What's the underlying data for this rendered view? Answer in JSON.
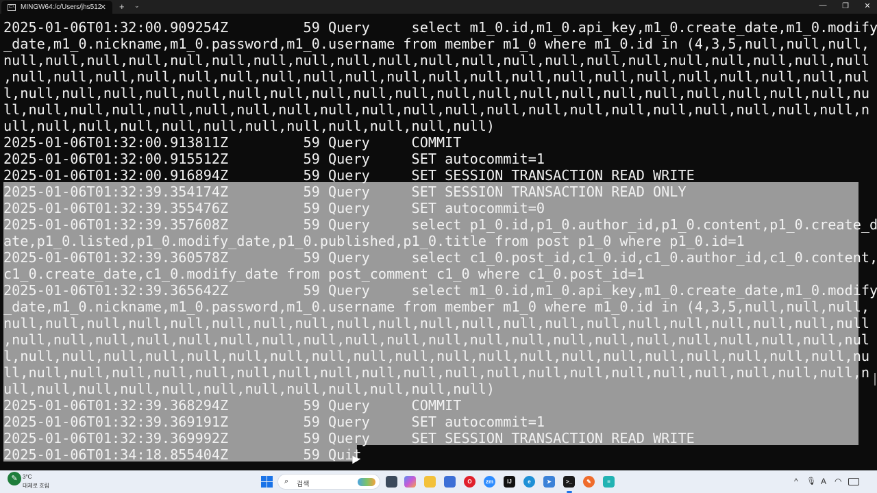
{
  "window": {
    "tab_title": "MINGW64:/c/Users/jhs512",
    "tab_icon_text": "C:\\",
    "new_tab_glyph": "+",
    "dropdown_glyph": "⌄",
    "close_glyph": "✕",
    "minimize_glyph": "—",
    "maximize_glyph": "❐"
  },
  "terminal": {
    "lines": [
      "2025-01-06T01:32:00.909254Z\t    59 Query\t select m1_0.id,m1_0.api_key,m1_0.create_date,m1_0.modify",
      "_date,m1_0.nickname,m1_0.password,m1_0.username from member m1_0 where m1_0.id in (4,3,5,null,null,null,",
      "null,null,null,null,null,null,null,null,null,null,null,null,null,null,null,null,null,null,null,null,null",
      ",null,null,null,null,null,null,null,null,null,null,null,null,null,null,null,null,null,null,null,null,nul",
      "l,null,null,null,null,null,null,null,null,null,null,null,null,null,null,null,null,null,null,null,null,nu",
      "ll,null,null,null,null,null,null,null,null,null,null,null,null,null,null,null,null,null,null,null,null,n",
      "ull,null,null,null,null,null,null,null,null,null,null,null)",
      "2025-01-06T01:32:00.913811Z\t    59 Query\t COMMIT",
      "2025-01-06T01:32:00.915512Z\t    59 Query\t SET autocommit=1",
      "2025-01-06T01:32:00.916894Z\t    59 Query\t SET SESSION TRANSACTION READ WRITE",
      "2025-01-06T01:32:39.354174Z\t    59 Query\t SET SESSION TRANSACTION READ ONLY",
      "2025-01-06T01:32:39.355476Z\t    59 Query\t SET autocommit=0",
      "2025-01-06T01:32:39.357608Z\t    59 Query\t select p1_0.id,p1_0.author_id,p1_0.content,p1_0.create_d",
      "ate,p1_0.listed,p1_0.modify_date,p1_0.published,p1_0.title from post p1_0 where p1_0.id=1",
      "2025-01-06T01:32:39.360578Z\t    59 Query\t select c1_0.post_id,c1_0.id,c1_0.author_id,c1_0.content,",
      "c1_0.create_date,c1_0.modify_date from post_comment c1_0 where c1_0.post_id=1",
      "2025-01-06T01:32:39.365642Z\t    59 Query\t select m1_0.id,m1_0.api_key,m1_0.create_date,m1_0.modify",
      "_date,m1_0.nickname,m1_0.password,m1_0.username from member m1_0 where m1_0.id in (4,3,5,null,null,null,",
      "null,null,null,null,null,null,null,null,null,null,null,null,null,null,null,null,null,null,null,null,null",
      ",null,null,null,null,null,null,null,null,null,null,null,null,null,null,null,null,null,null,null,null,nul",
      "l,null,null,null,null,null,null,null,null,null,null,null,null,null,null,null,null,null,null,null,null,nu",
      "ll,null,null,null,null,null,null,null,null,null,null,null,null,null,null,null,null,null,null,null,null,n",
      "ull,null,null,null,null,null,null,null,null,null,null,null)",
      "2025-01-06T01:32:39.368294Z\t    59 Query\t COMMIT",
      "2025-01-06T01:32:39.369191Z\t    59 Query\t SET autocommit=1",
      "2025-01-06T01:32:39.369992Z\t    59 Query\t SET SESSION TRANSACTION READ WRITE",
      "2025-01-06T01:34:18.855404Z\t    59 Quit"
    ],
    "colors": {
      "background": "#0c0c0c",
      "text": "#f2f2f2",
      "selection": "#9a9a9a"
    }
  },
  "taskbar": {
    "weather_temp": "3°C",
    "weather_desc": "대체로 흐림",
    "search_label": "검색",
    "apps": [
      "file-explorer-icon",
      "copilot-icon",
      "folder-icon",
      "opera-icon",
      "zoom-icon",
      "intellij-icon",
      "edge-icon",
      "arrow-app-icon",
      "terminal-icon",
      "postman-icon",
      "notepad-icon"
    ],
    "tray": {
      "chevron": "^",
      "mic": "🎙",
      "font": "A",
      "wifi": "◠"
    }
  }
}
